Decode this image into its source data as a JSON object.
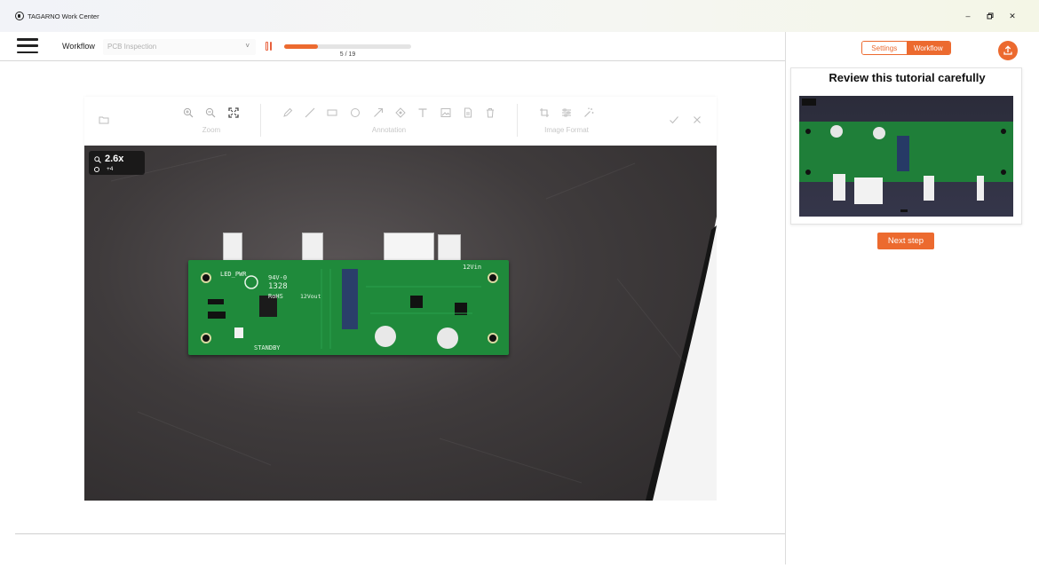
{
  "window": {
    "title": "TAGARNO Work Center",
    "icon": "tagarno-logo-icon",
    "controls": [
      "minimize-icon",
      "restore-icon",
      "close-icon"
    ]
  },
  "header": {
    "workflow_label": "Workflow",
    "workflow_select": "PCB Inspection",
    "progress": {
      "current": 5,
      "total": 19,
      "text": "5 / 19"
    }
  },
  "toolbar": {
    "groups": {
      "zoom": "Zoom",
      "annotation": "Annotation",
      "image_format": "Image Format"
    }
  },
  "viewer": {
    "zoom_text": "2.6x",
    "sub_text": "+4",
    "board_labels": [
      "LED_PWR",
      "94V-0",
      "1328",
      "RoHS",
      "12Vout",
      "12Vin",
      "STANDBY"
    ]
  },
  "right_panel": {
    "tabs": [
      {
        "label": "Settings",
        "active": false
      },
      {
        "label": "Workflow",
        "active": true
      }
    ],
    "tutorial_title": "Review this tutorial carefully",
    "next_button": "Next step"
  },
  "colors": {
    "accent": "#ec6a2f",
    "pcb_green": "#1f8a3b"
  }
}
